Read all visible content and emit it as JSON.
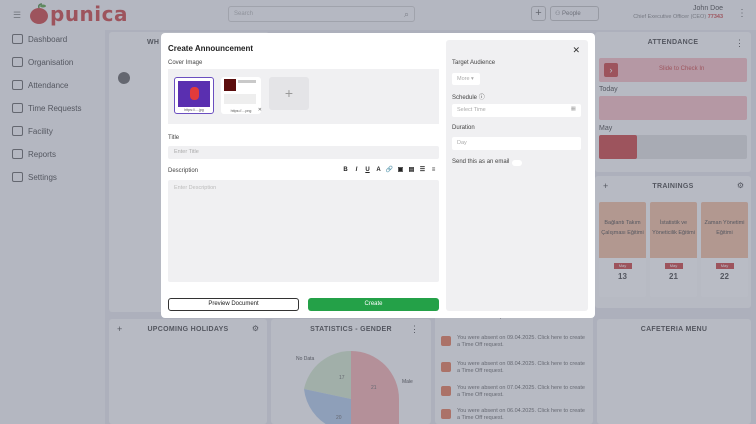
{
  "header": {
    "brand": "punica",
    "search_placeholder": "Search",
    "people_label": "People",
    "user_name": "John Doe",
    "user_role": "Chief Executive Officer (CEO)",
    "user_id": "77343"
  },
  "sidebar": {
    "items": [
      {
        "label": "Dashboard"
      },
      {
        "label": "Organisation"
      },
      {
        "label": "Attendance"
      },
      {
        "label": "Time Requests"
      },
      {
        "label": "Facility"
      },
      {
        "label": "Reports"
      },
      {
        "label": "Settings"
      }
    ]
  },
  "background": {
    "who_card_title": "WH",
    "attendance_title": "ATTENDANCE",
    "slide_label": "Slide to Check In",
    "today_label": "Today",
    "may_label": "May",
    "trainings_title": "TRAININGS",
    "trainings": [
      {
        "name": "Bağlantı Takım Çalışması Eğitimi",
        "month": "May",
        "day": "13"
      },
      {
        "name": "İstatistik ve Yöneticilik Eğitimi",
        "month": "May",
        "day": "21"
      },
      {
        "name": "Zaman Yönetimi Eğitimi",
        "month": "May",
        "day": "22"
      }
    ],
    "holidays_title": "UPCOMING HOLIDAYS",
    "stats_title": "STATISTICS - GENDER",
    "stats_labels": {
      "no_data": "No Data",
      "male": "Male"
    },
    "chart_values": [
      "17",
      "21",
      "20"
    ],
    "cafeteria_title": "CAFETERIA MENU",
    "notifications": [
      "ate a Time Off request.",
      "You were absent on 09.04.2025. Click here to create a Time Off request.",
      "You were absent on 08.04.2025. Click here to create a Time Off request.",
      "You were absent on 07.04.2025. Click here to create a Time Off request.",
      "You were absent on 06.04.2025. Click here to create a Time Off request."
    ]
  },
  "modal": {
    "title": "Create Announcement",
    "cover_image_label": "Cover Image",
    "thumb1_caption": "https://....jpg",
    "thumb2_caption": "https://....png",
    "title_label": "Title",
    "title_placeholder": "Enter Title",
    "description_label": "Description",
    "description_placeholder": "Enter Description",
    "toolbar": [
      "B",
      "I",
      "U",
      "A",
      "🔗",
      "▣",
      "▤",
      "☰",
      "≡"
    ],
    "preview_button": "Preview Document",
    "create_button": "Create",
    "target_audience_label": "Target Audience",
    "target_audience_value": "More",
    "schedule_label": "Schedule",
    "schedule_placeholder": "Select Time",
    "duration_label": "Duration",
    "duration_placeholder": "Day",
    "send_email_label": "Send this as an email"
  },
  "colors": {
    "brand": "#c62f2f",
    "create_button": "#24a148",
    "accent": "#6b4fc0"
  }
}
